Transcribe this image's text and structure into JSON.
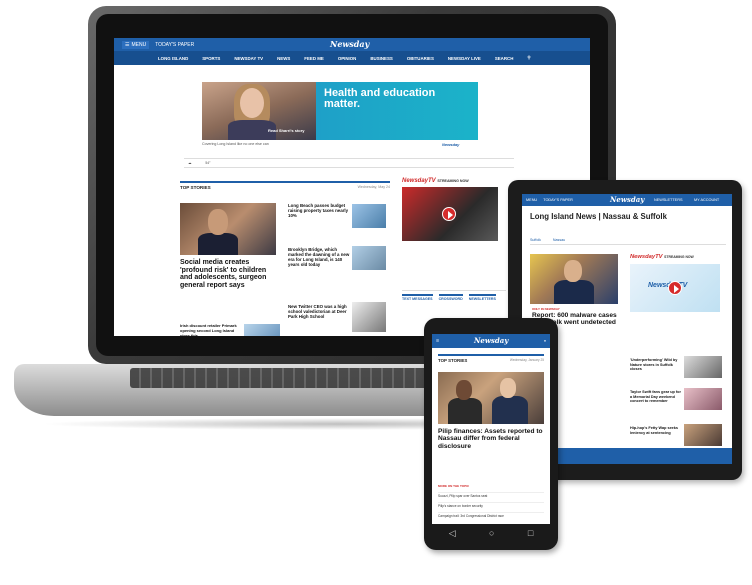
{
  "brand": {
    "name": "Newsday",
    "accent": "#1f5fa8",
    "red": "#d12a2a"
  },
  "laptop": {
    "topbar": {
      "menu": "MENU",
      "todays_paper": "TODAY'S PAPER"
    },
    "nav": [
      "LONG ISLAND",
      "SPORTS",
      "NEWSDAY TV",
      "NEWS",
      "FEED ME",
      "OPINION",
      "BUSINESS",
      "OBITUARIES",
      "NEWSDAY LIVE",
      "SEARCH"
    ],
    "ad": {
      "headline": "Health and education matter.",
      "cta": "Read Sharri's story",
      "caption": "Covering Long Island like no one else can",
      "brand": "Newsday"
    },
    "weather": "54°",
    "section": {
      "title": "TOP STORIES",
      "date": "Wednesday, May 24"
    },
    "lead": {
      "headline": "Social media creates 'profound risk' to children and adolescents, surgeon general report says"
    },
    "side_stories": [
      "Long Beach passes budget raising property taxes nearly 10%",
      "Brooklyn Bridge, which marked the dawning of a new era for Long Island, is 140 years old today",
      "New Twitter CEO was a high school valedictorian at Deer Park High School"
    ],
    "small_story": "Irish discount retailer Primark opening second Long Island store this",
    "tv": {
      "brand": "NewsdayTV",
      "label": "STREAMING NOW"
    },
    "promos": [
      "TEXT MESSAGES",
      "CROSSWORD",
      "NEWSLETTERS"
    ]
  },
  "tablet": {
    "topbar": {
      "menu": "MENU",
      "todays_paper": "TODAY'S PAPER",
      "newsletters": "NEWSLETTERS",
      "account": "MY ACCOUNT"
    },
    "title": "Long Island News | Nassau & Suffolk",
    "subnav": [
      "Suffolk",
      "Nassau"
    ],
    "lead": {
      "tag": "ONLY IN NEWSDAY",
      "headline": "Report: 600 malware cases in Suffolk went undetected for"
    },
    "tv": {
      "brand": "NewsdayTV",
      "label": "STREAMING NOW",
      "player": "NewsdayTV"
    },
    "items": [
      "'Underperforming' Wild by Nature stores in Suffolk closes",
      "Taylor Swift fans gear up for a Memorial Day weekend concert to remember",
      "Hip-hop's Fetty Wap seeks leniency at sentencing"
    ]
  },
  "phone": {
    "logo": "Newsday",
    "section": {
      "title": "TOP STORIES",
      "date": "Wednesday, January 25"
    },
    "lead": {
      "headline": "Pilip finances: Assets reported to Nassau differ from federal disclosure"
    },
    "tag": "MORE ON THE TOPIC",
    "lines": [
      "Suozzi, Pilip spar over Santos seat",
      "Pilip's stance on border security",
      "Campaign trail: 3rd Congressional District race"
    ],
    "buttons": [
      "◁",
      "○",
      "□"
    ]
  }
}
